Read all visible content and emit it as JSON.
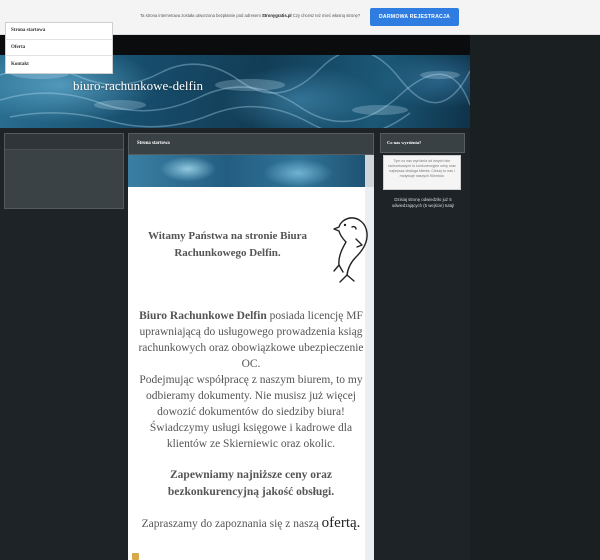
{
  "promo": {
    "text_before": "Ta strona internetowa została utworzona bezpłatnie pod adresem",
    "domain": "Stronygratis.pl",
    "text_after": "Czy chcesz też mieć własną stronę?",
    "button_label": "DARMOWA REJESTRACJA",
    "button_color": "#2f7de1"
  },
  "header": {
    "site_title": "biuro-rachunkowe-delfin"
  },
  "menu": {
    "items": [
      {
        "label": "Strona startowa"
      },
      {
        "label": "Oferta"
      },
      {
        "label": "Kontakt"
      }
    ]
  },
  "main": {
    "section_label": "Strona startowa",
    "welcome_line1": "Witamy Państwa na stronie Biura",
    "welcome_line2": "Rachunkowego Delfin.",
    "intro_bold": "Biuro Rachunkowe Delfin",
    "intro_rest": "posiada licencję MF uprawniającą do usługowego prowadzenia ksiąg rachunkowych oraz obowiązkowe ubezpieczenie OC.",
    "intro_p2": "Podejmując współpracę z naszym biurem, to my odbieramy dokumenty. Nie musisz już więcej dowozić dokumentów do siedziby biura!",
    "intro_p3": "Świadczymy usługi księgowe i kadrowe dla klientów ze Skierniewic oraz okolic.",
    "guarantee_line1": "Zapewniamy najniższe ceny oraz",
    "guarantee_line2": "bezkonkurencyjną jakość obsługi.",
    "invite_text": "Zapraszamy do zapoznania się z naszą",
    "invite_link": "ofertą."
  },
  "sidebar_right": {
    "title": "Co nas wyróżnia?",
    "box_text": "Tym co nas wyróżnia od innych biur rachunkowych to konkurencyjne ceny oraz najlepsza obsługa klienta. Cieszy to nas i motywuje naszych Klientów.",
    "counter_line1": "Dzisiaj stronę odwiedziło już 5",
    "counter_line2": "odwiedzających (5 wejście) tutaj!"
  }
}
